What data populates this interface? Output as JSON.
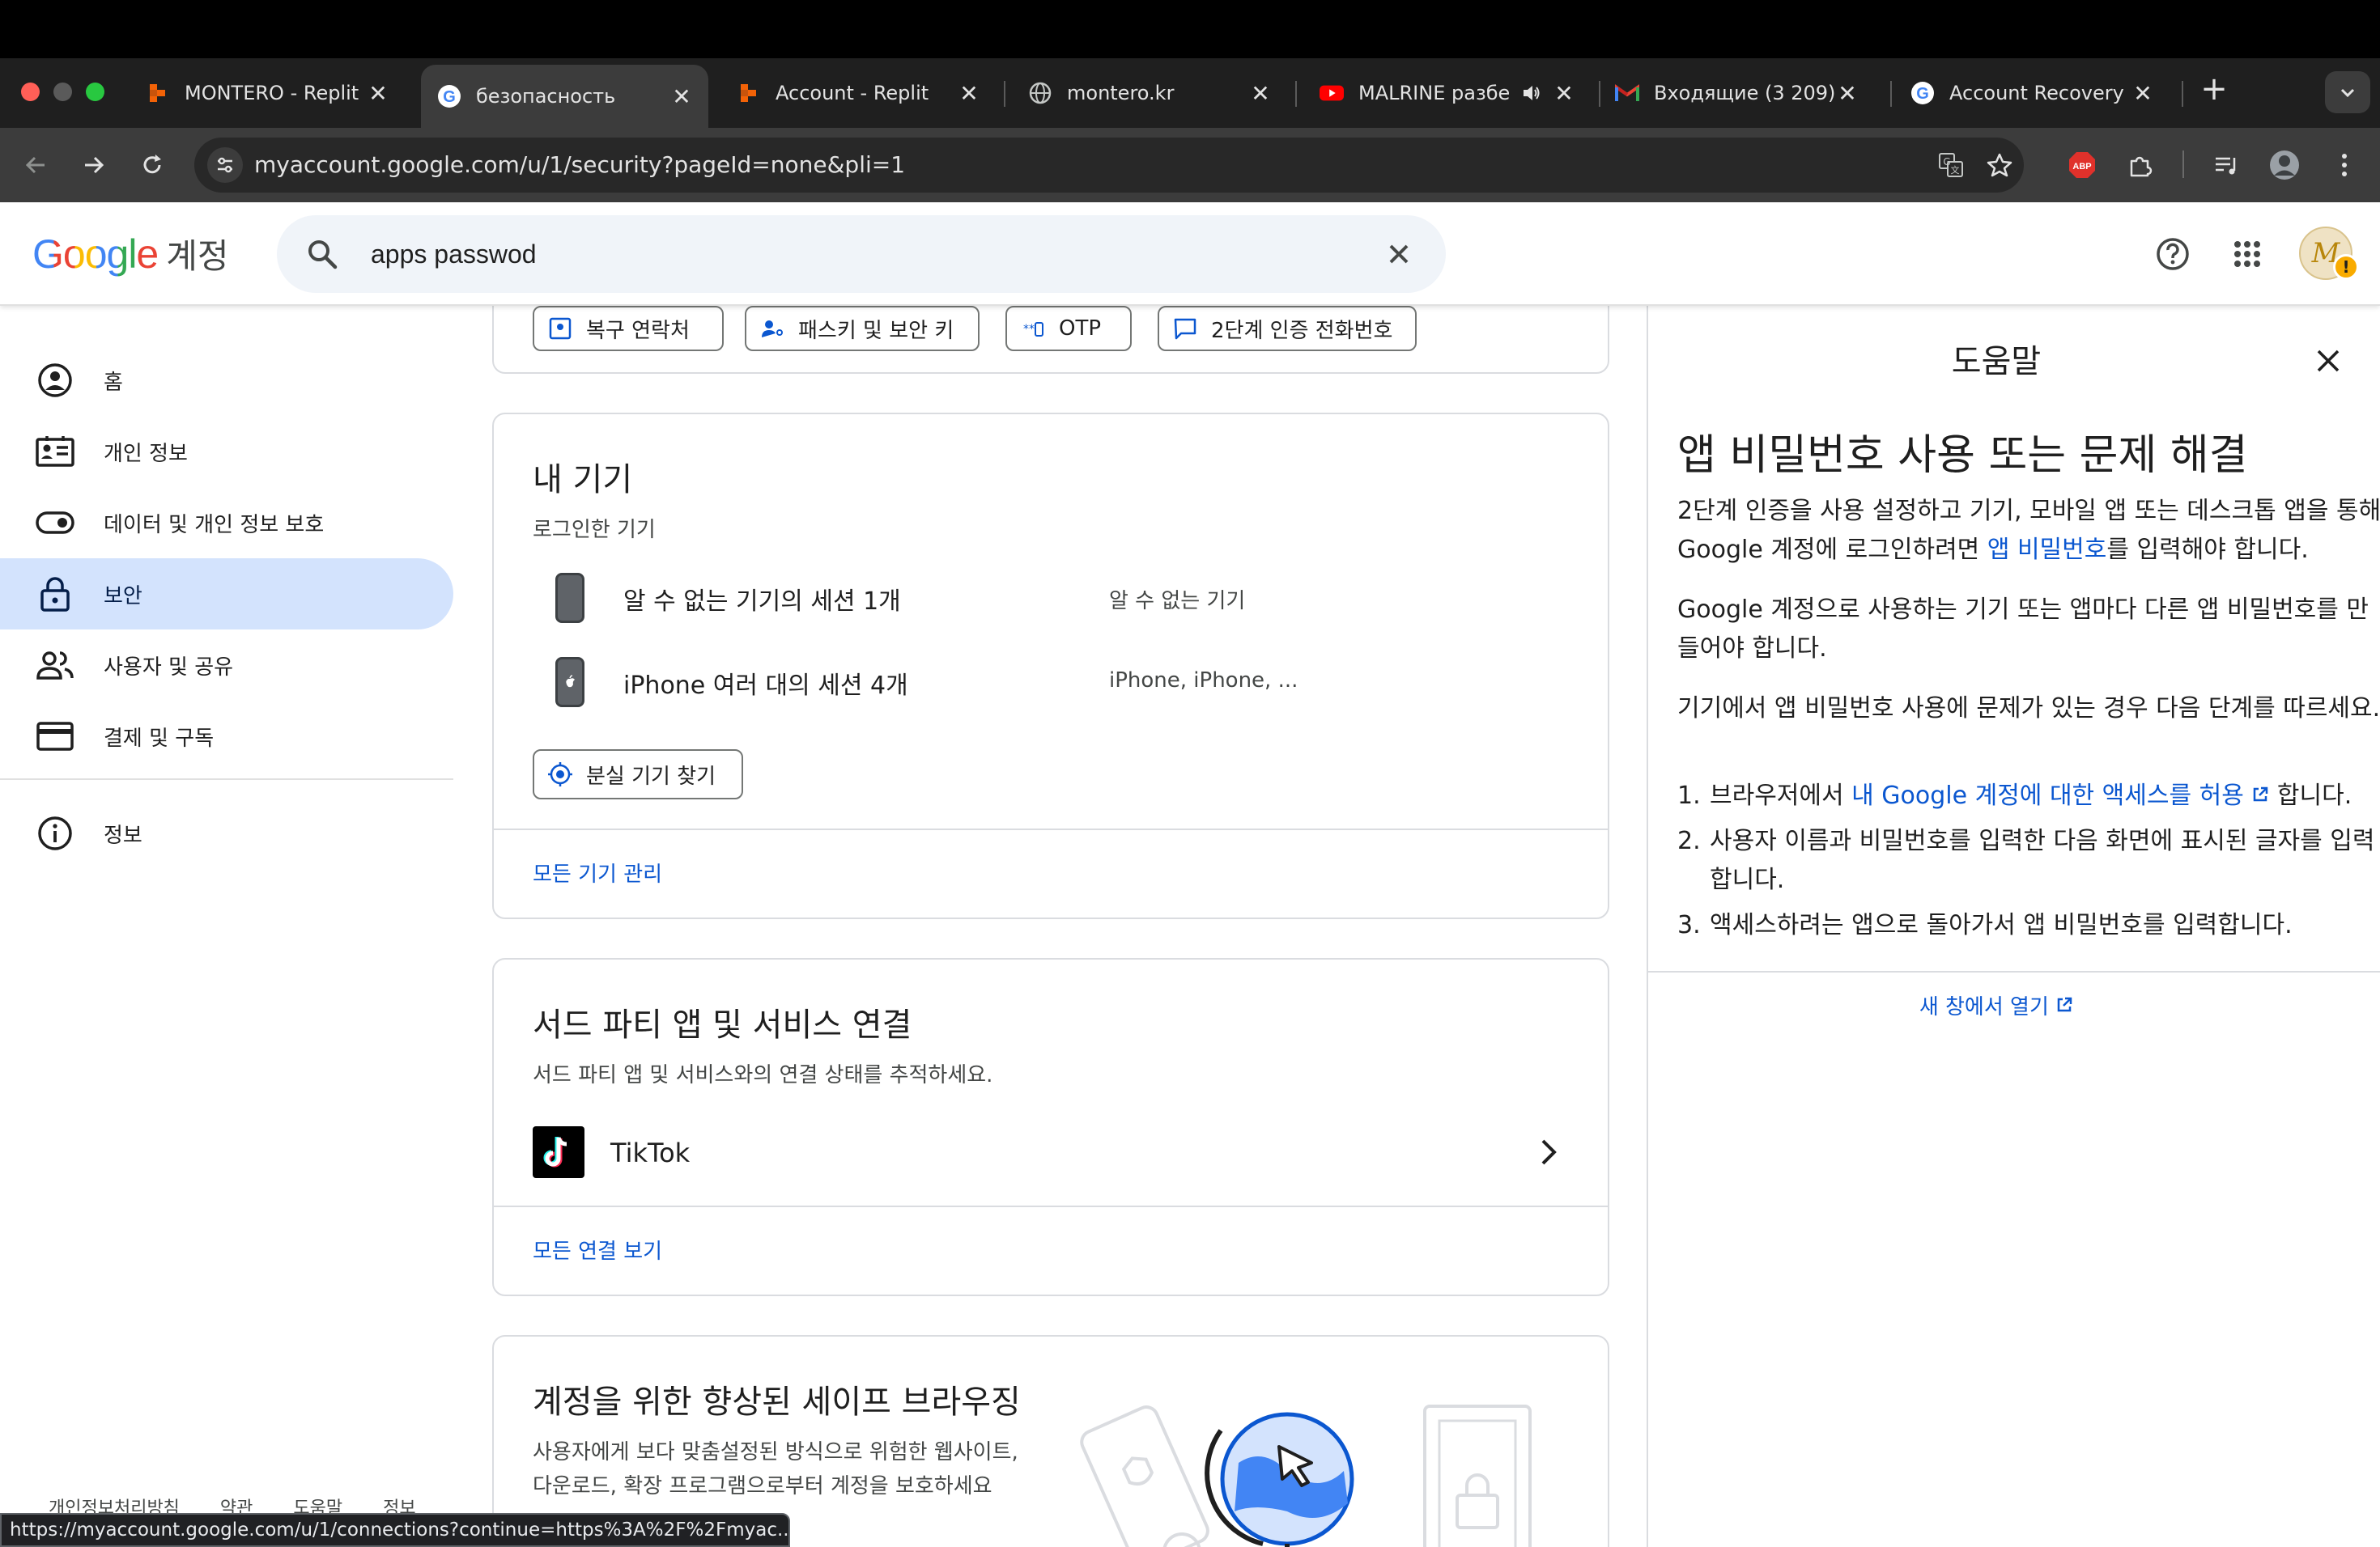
{
  "browser": {
    "tabs": [
      {
        "title": "MONTERO - Replit",
        "active": false
      },
      {
        "title": "безопасность",
        "active": true
      },
      {
        "title": "Account - Replit",
        "active": false
      },
      {
        "title": "montero.kr",
        "active": false
      },
      {
        "title": "MALRINE разбе",
        "active": false
      },
      {
        "title": "Входящие (3 209)",
        "active": false
      },
      {
        "title": "Account Recovery",
        "active": false
      }
    ],
    "url": "myaccount.google.com/u/1/security?pageId=none&pli=1",
    "extension_badge": "ABP"
  },
  "header": {
    "logo": "Google",
    "logo_sub": "계정",
    "search_value": "apps passwod"
  },
  "nav": {
    "items": [
      {
        "label": "홈",
        "icon": "home-icon"
      },
      {
        "label": "개인 정보",
        "icon": "id-card-icon"
      },
      {
        "label": "데이터 및 개인 정보 보호",
        "icon": "toggle-icon"
      },
      {
        "label": "보안",
        "icon": "lock-icon",
        "active": true
      },
      {
        "label": "사용자 및 공유",
        "icon": "people-icon"
      },
      {
        "label": "결제 및 구독",
        "icon": "card-icon"
      }
    ],
    "info_label": "정보",
    "footer": [
      "개인정보처리방침",
      "약관",
      "도움말",
      "정보"
    ]
  },
  "top_card": {
    "chips": [
      "복구 연락처",
      "패스키 및 보안 키",
      "OTP",
      "2단계 인증 전화번호"
    ]
  },
  "devices": {
    "title": "내 기기",
    "subtitle": "로그인한 기기",
    "rows": [
      {
        "name": "알 수 없는 기기의 세션 1개",
        "type": "알 수 없는 기기"
      },
      {
        "name": "iPhone 여러 대의 세션 4개",
        "type": "iPhone, iPhone, ..."
      }
    ],
    "find_button": "분실 기기 찾기",
    "manage_link": "모든 기기 관리"
  },
  "third_party": {
    "title": "서드 파티 앱 및 서비스 연결",
    "subtitle": "서드 파티 앱 및 서비스와의 연결 상태를 추적하세요.",
    "app": "TikTok",
    "all_link": "모든 연결 보기"
  },
  "safe_browsing": {
    "title": "계정을 위한 향상된 세이프 브라우징",
    "line1": "사용자에게 보다 맞춤설정된 방식으로 위험한 웹사이트,",
    "line2": "다운로드, 확장 프로그램으로부터 계정을 보호하세요"
  },
  "help": {
    "panel_title": "도움말",
    "heading": "앱 비밀번호 사용 또는 문제 해결",
    "p1_a": "2단계 인증을 사용 설정하고 기기, 모바일 앱 또는 데스크톱 앱을 통해 Google 계정에 로그인하려면 ",
    "p1_link": "앱 비밀번호",
    "p1_b": "를 입력해야 합니다.",
    "p2": "Google 계정으로 사용하는 기기 또는 앱마다 다른 앱 비밀번호를 만들어야 합니다.",
    "p3": "기기에서 앱 비밀번호 사용에 문제가 있는 경우 다음 단계를 따르세요.",
    "step1_a": "브라우저에서 ",
    "step1_link": "내 Google 계정에 대한 액세스를 허용",
    "step1_b": " 합니다.",
    "step2": "사용자 이름과 비밀번호를 입력한 다음 화면에 표시된 글자를 입력합니다.",
    "step3": "액세스하려는 앱으로 돌아가서 앱 비밀번호를 입력합니다.",
    "open_new": "새 창에서 열기"
  },
  "status_url": "https://myaccount.google.com/u/1/connections?continue=https%3A%2F%2Fmyac..."
}
